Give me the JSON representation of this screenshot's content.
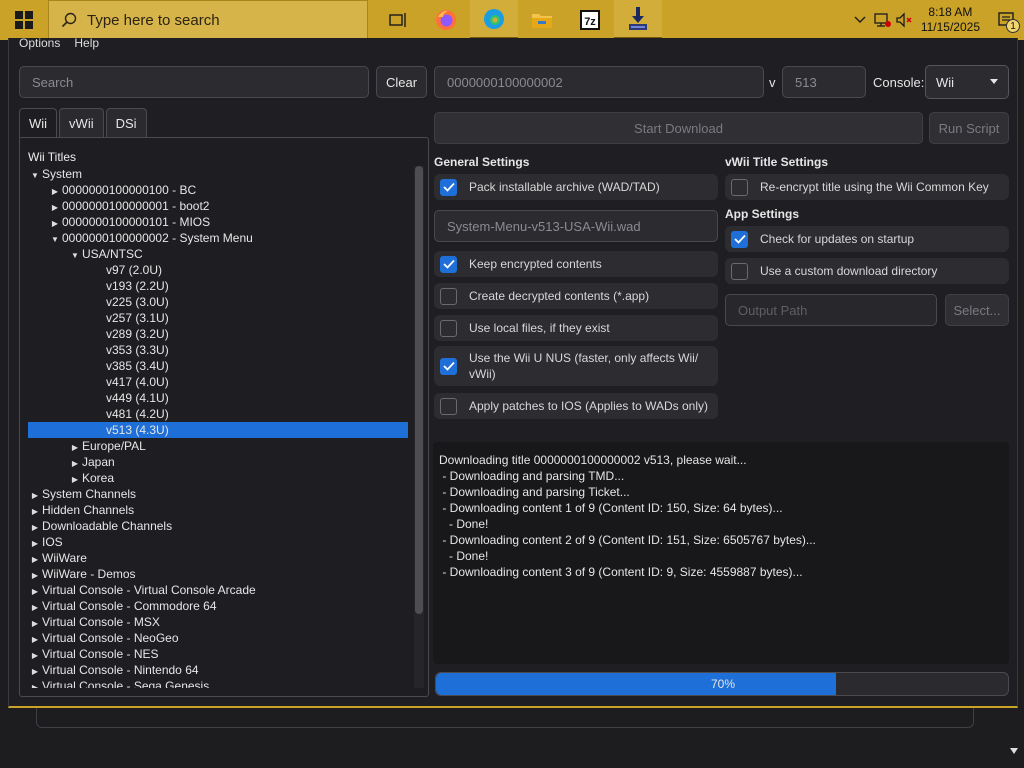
{
  "taskbar": {
    "search_placeholder": "Type here to search",
    "apps": [
      "task-view",
      "firefox",
      "edge",
      "file-explorer",
      "7zip",
      "nusget"
    ],
    "time": "8:18 AM",
    "date": "11/15/2025",
    "notification_count": "1",
    "accent": "#c9a227"
  },
  "menu": [
    "Options",
    "Help"
  ],
  "search": {
    "placeholder": "Search",
    "clear_label": "Clear"
  },
  "tid_field": {
    "value": "0000000100000002"
  },
  "version": {
    "label": "v",
    "value": "513"
  },
  "console": {
    "label": "Console:",
    "value": "Wii"
  },
  "buttons": {
    "start_download": "Start Download",
    "run_script": "Run Script",
    "select": "Select..."
  },
  "tabs": [
    "Wii",
    "vWii",
    "DSi"
  ],
  "tree": {
    "header": "Wii Titles",
    "rows": [
      {
        "text": "System",
        "depth": 0,
        "state": "open"
      },
      {
        "text": "0000000100000100 - BC",
        "depth": 1,
        "state": "closed"
      },
      {
        "text": "0000000100000001 - boot2",
        "depth": 1,
        "state": "closed"
      },
      {
        "text": "0000000100000101 - MIOS",
        "depth": 1,
        "state": "closed"
      },
      {
        "text": "0000000100000002 - System Menu",
        "depth": 1,
        "state": "open"
      },
      {
        "text": "USA/NTSC",
        "depth": 2,
        "state": "open"
      },
      {
        "text": "v97 (2.0U)",
        "depth": 3,
        "state": "leaf"
      },
      {
        "text": "v193 (2.2U)",
        "depth": 3,
        "state": "leaf"
      },
      {
        "text": "v225 (3.0U)",
        "depth": 3,
        "state": "leaf"
      },
      {
        "text": "v257 (3.1U)",
        "depth": 3,
        "state": "leaf"
      },
      {
        "text": "v289 (3.2U)",
        "depth": 3,
        "state": "leaf"
      },
      {
        "text": "v353 (3.3U)",
        "depth": 3,
        "state": "leaf"
      },
      {
        "text": "v385 (3.4U)",
        "depth": 3,
        "state": "leaf"
      },
      {
        "text": "v417 (4.0U)",
        "depth": 3,
        "state": "leaf"
      },
      {
        "text": "v449 (4.1U)",
        "depth": 3,
        "state": "leaf"
      },
      {
        "text": "v481 (4.2U)",
        "depth": 3,
        "state": "leaf"
      },
      {
        "text": "v513 (4.3U)",
        "depth": 3,
        "state": "leaf",
        "selected": true
      },
      {
        "text": "Europe/PAL",
        "depth": 2,
        "state": "closed"
      },
      {
        "text": "Japan",
        "depth": 2,
        "state": "closed"
      },
      {
        "text": "Korea",
        "depth": 2,
        "state": "closed"
      },
      {
        "text": "System Channels",
        "depth": 0,
        "state": "closed"
      },
      {
        "text": "Hidden Channels",
        "depth": 0,
        "state": "closed"
      },
      {
        "text": "Downloadable Channels",
        "depth": 0,
        "state": "closed"
      },
      {
        "text": "IOS",
        "depth": 0,
        "state": "closed"
      },
      {
        "text": "WiiWare",
        "depth": 0,
        "state": "closed"
      },
      {
        "text": "WiiWare - Demos",
        "depth": 0,
        "state": "closed"
      },
      {
        "text": "Virtual Console - Virtual Console Arcade",
        "depth": 0,
        "state": "closed"
      },
      {
        "text": "Virtual Console - Commodore 64",
        "depth": 0,
        "state": "closed"
      },
      {
        "text": "Virtual Console - MSX",
        "depth": 0,
        "state": "closed"
      },
      {
        "text": "Virtual Console - NeoGeo",
        "depth": 0,
        "state": "closed"
      },
      {
        "text": "Virtual Console - NES",
        "depth": 0,
        "state": "closed"
      },
      {
        "text": "Virtual Console - Nintendo 64",
        "depth": 0,
        "state": "closed"
      },
      {
        "text": "Virtual Console - Sega Genesis",
        "depth": 0,
        "state": "closed"
      }
    ]
  },
  "general_settings": {
    "heading": "General Settings",
    "pack_archive": {
      "label": "Pack installable archive (WAD/TAD)",
      "checked": true
    },
    "archive_name": "System-Menu-v513-USA-Wii.wad",
    "keep_encrypted": {
      "label": "Keep encrypted contents",
      "checked": true
    },
    "create_decrypted": {
      "label": "Create decrypted contents (*.app)",
      "checked": false
    },
    "use_local": {
      "label": "Use local files, if they exist",
      "checked": false
    },
    "use_wiiu_nus": {
      "label_line1": "Use the Wii U NUS (faster, only affects Wii/",
      "label_line2": "vWii)",
      "checked": true
    },
    "apply_patches": {
      "label": "Apply patches to IOS (Applies to WADs only)",
      "checked": false
    }
  },
  "vwii_settings": {
    "heading": "vWii Title Settings",
    "reencrypt": {
      "label": "Re-encrypt title using the Wii Common Key",
      "checked": false
    }
  },
  "app_settings": {
    "heading": "App Settings",
    "check_updates": {
      "label": "Check for updates on startup",
      "checked": true
    },
    "custom_dir": {
      "label": "Use a custom download directory",
      "checked": false
    },
    "output_placeholder": "Output Path"
  },
  "log": [
    "Downloading title 0000000100000002 v513, please wait...",
    " - Downloading and parsing TMD...",
    " - Downloading and parsing Ticket...",
    " - Downloading content 1 of 9 (Content ID: 150, Size: 64 bytes)...",
    "   - Done!",
    " - Downloading content 2 of 9 (Content ID: 151, Size: 6505767 bytes)...",
    "   - Done!",
    " - Downloading content 3 of 9 (Content ID: 9, Size: 4559887 bytes)..."
  ],
  "progress": {
    "value": 0.7,
    "text": "70%",
    "color": "#1f6fd8"
  }
}
